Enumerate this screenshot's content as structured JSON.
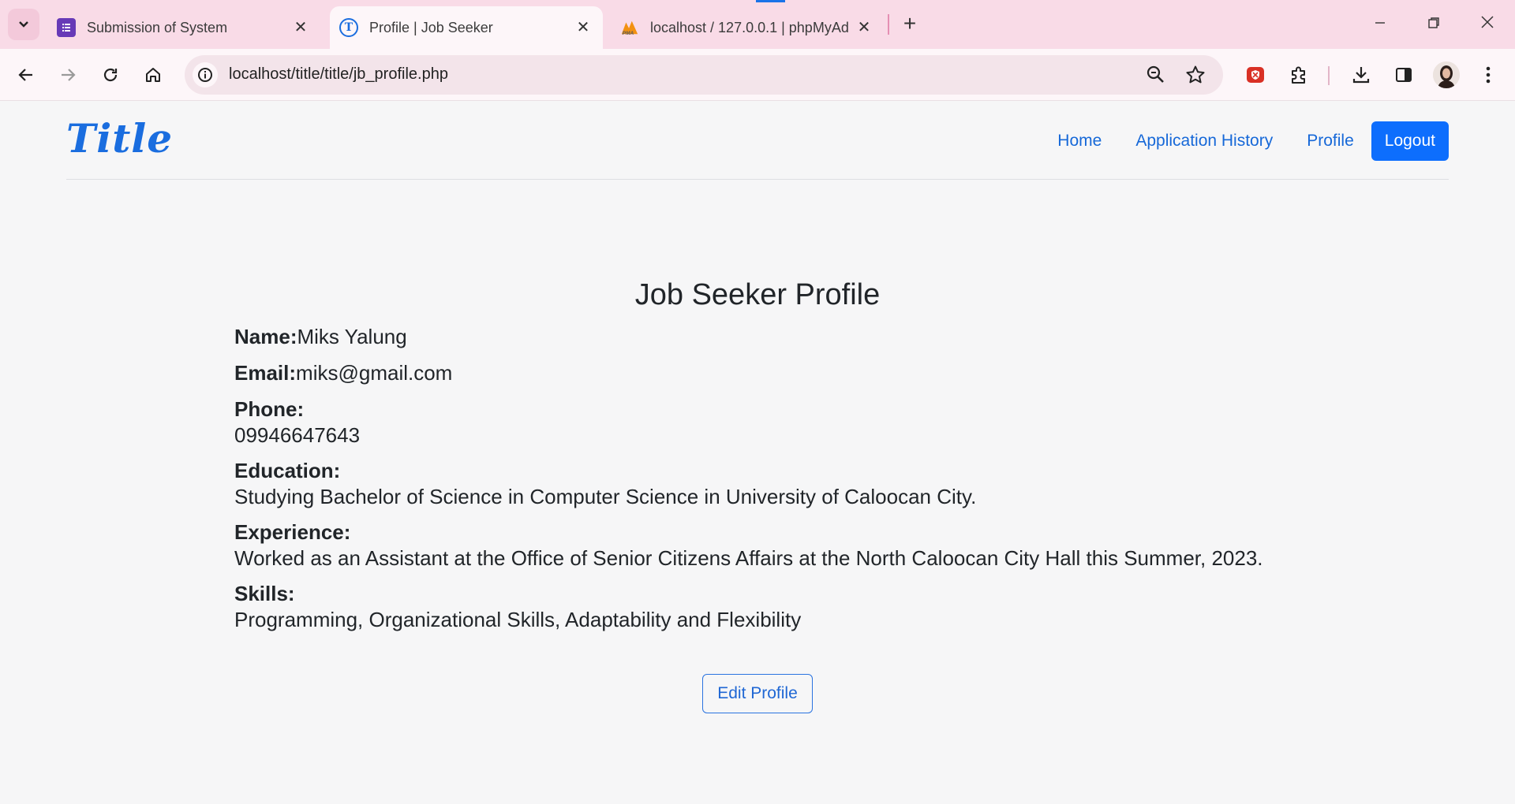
{
  "browser": {
    "tabs": [
      {
        "title": "Submission of System",
        "favicon": "forms-icon"
      },
      {
        "title": "Profile | Job Seeker",
        "favicon": "title-site-icon",
        "active": true
      },
      {
        "title": "localhost / 127.0.0.1 | phpMyAd",
        "favicon": "phpmyadmin-icon"
      }
    ],
    "url": "localhost/title/title/jb_profile.php",
    "accent": "#1a73e8"
  },
  "site": {
    "brand": "Title",
    "nav": {
      "home": "Home",
      "history": "Application History",
      "profile": "Profile",
      "logout": "Logout"
    },
    "brand_color": "#1a6ddf",
    "primary_color": "#0d6efd"
  },
  "profile": {
    "title": "Job Seeker Profile",
    "name_label": "Name:",
    "name": "Miks Yalung",
    "email_label": "Email:",
    "email": "miks@gmail.com",
    "phone_label": "Phone:",
    "phone": "09946647643",
    "education_label": "Education:",
    "education": "Studying Bachelor of Science in Computer Science in University of Caloocan City.",
    "experience_label": "Experience:",
    "experience": "Worked as an Assistant at the Office of Senior Citizens Affairs at the North Caloocan City Hall this Summer, 2023.",
    "skills_label": "Skills:",
    "skills": "Programming, Organizational Skills, Adaptability and Flexibility",
    "edit_label": "Edit Profile"
  }
}
